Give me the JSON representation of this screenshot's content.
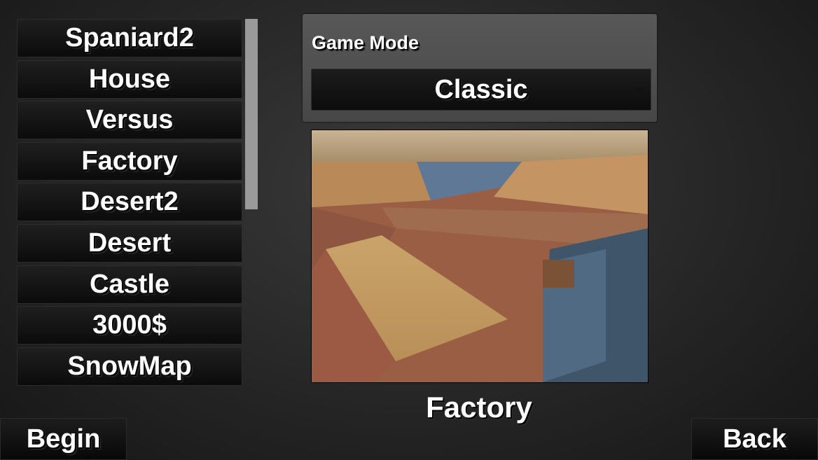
{
  "maps": [
    "Spaniard2",
    "House",
    "Versus",
    "Factory",
    "Desert2",
    "Desert",
    "Castle",
    "3000$",
    "SnowMap"
  ],
  "game_mode": {
    "label": "Game Mode",
    "selected": "Classic"
  },
  "selected_map": "Factory",
  "buttons": {
    "begin": "Begin",
    "back": "Back"
  }
}
